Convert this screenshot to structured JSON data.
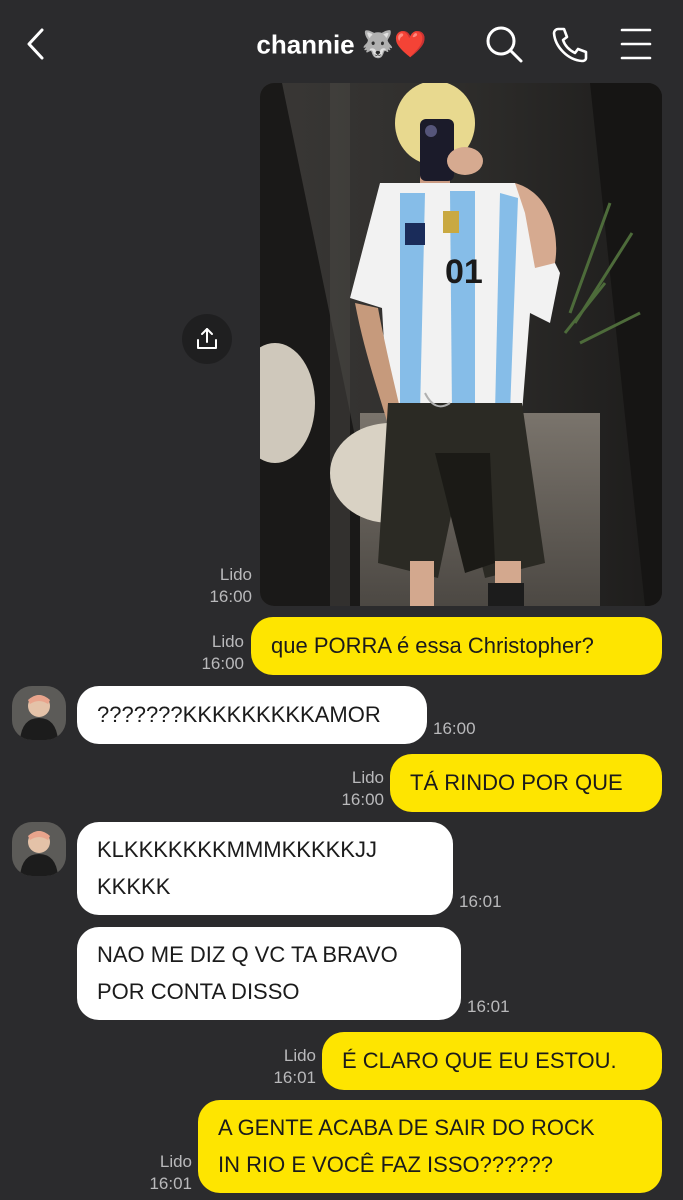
{
  "header": {
    "title": "channie",
    "title_emoji": "🐺❤️",
    "back_icon": "chevron-left-icon",
    "search_icon": "search-icon",
    "call_icon": "phone-icon",
    "menu_icon": "menu-icon"
  },
  "colors": {
    "background": "#2b2b2d",
    "outgoing_bubble": "#fee500",
    "incoming_bubble": "#ffffff",
    "meta_text": "#b9b9bb"
  },
  "messages": [
    {
      "type": "image",
      "direction": "out",
      "read": "Lido",
      "time": "16:00",
      "share_icon": "share-upload-icon"
    },
    {
      "direction": "out",
      "read": "Lido",
      "time": "16:00",
      "text": "que PORRA é essa Christopher?"
    },
    {
      "direction": "in",
      "time": "16:00",
      "lines": [
        "???????KKKKKKKKKAMOR"
      ]
    },
    {
      "direction": "out",
      "read": "Lido",
      "time": "16:00",
      "text": "TÁ RINDO POR QUE"
    },
    {
      "direction": "in",
      "time": "16:01",
      "lines": [
        "KLKKKKKKKMMMKKKKKJJ",
        "KKKKK"
      ]
    },
    {
      "direction": "in",
      "time": "16:01",
      "lines": [
        "NAO ME DIZ Q VC TA BRAVO",
        "POR CONTA DISSO"
      ]
    },
    {
      "direction": "out",
      "read": "Lido",
      "time": "16:01",
      "text": "É CLARO QUE EU ESTOU."
    },
    {
      "direction": "out",
      "read": "Lido",
      "time": "16:01",
      "lines": [
        "A GENTE ACABA DE SAIR DO ROCK",
        "IN RIO E VOCÊ FAZ ISSO??????"
      ]
    }
  ]
}
